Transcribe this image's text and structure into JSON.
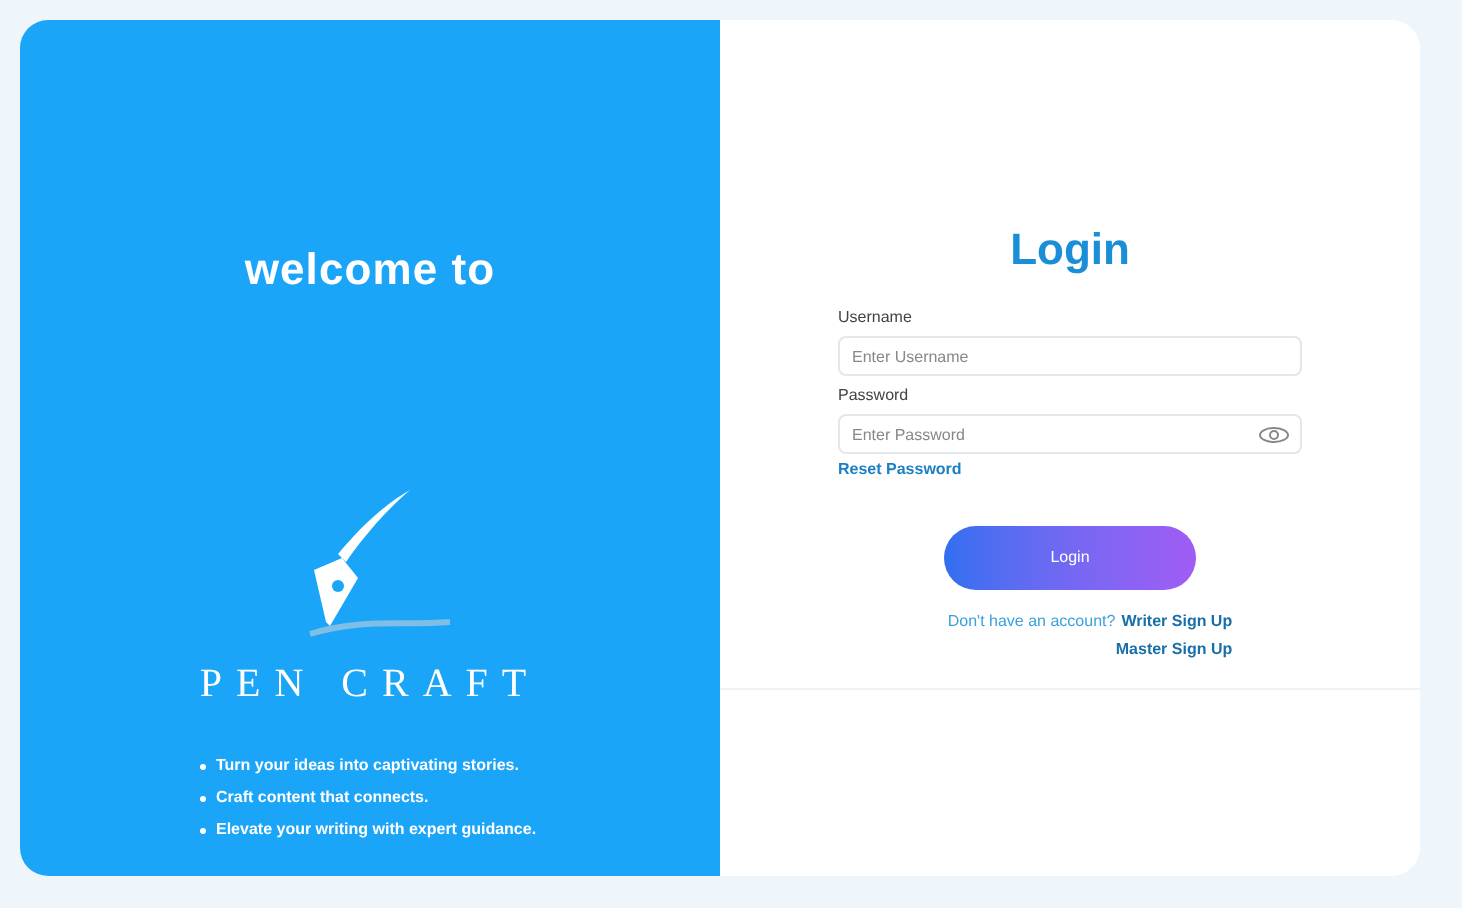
{
  "welcome": {
    "heading": "welcome to",
    "brand": "PEN CRAFT",
    "features": [
      "Turn your ideas into captivating stories.",
      "Craft content that connects.",
      "Elevate your writing with expert guidance."
    ]
  },
  "login": {
    "title": "Login",
    "username": {
      "label": "Username",
      "placeholder": "Enter Username"
    },
    "password": {
      "label": "Password",
      "placeholder": "Enter Password"
    },
    "reset_link": "Reset Password",
    "submit": "Login",
    "signup_prompt": "Don't have an account?",
    "writer_signup": "Writer Sign Up",
    "master_signup": "Master Sign Up"
  }
}
